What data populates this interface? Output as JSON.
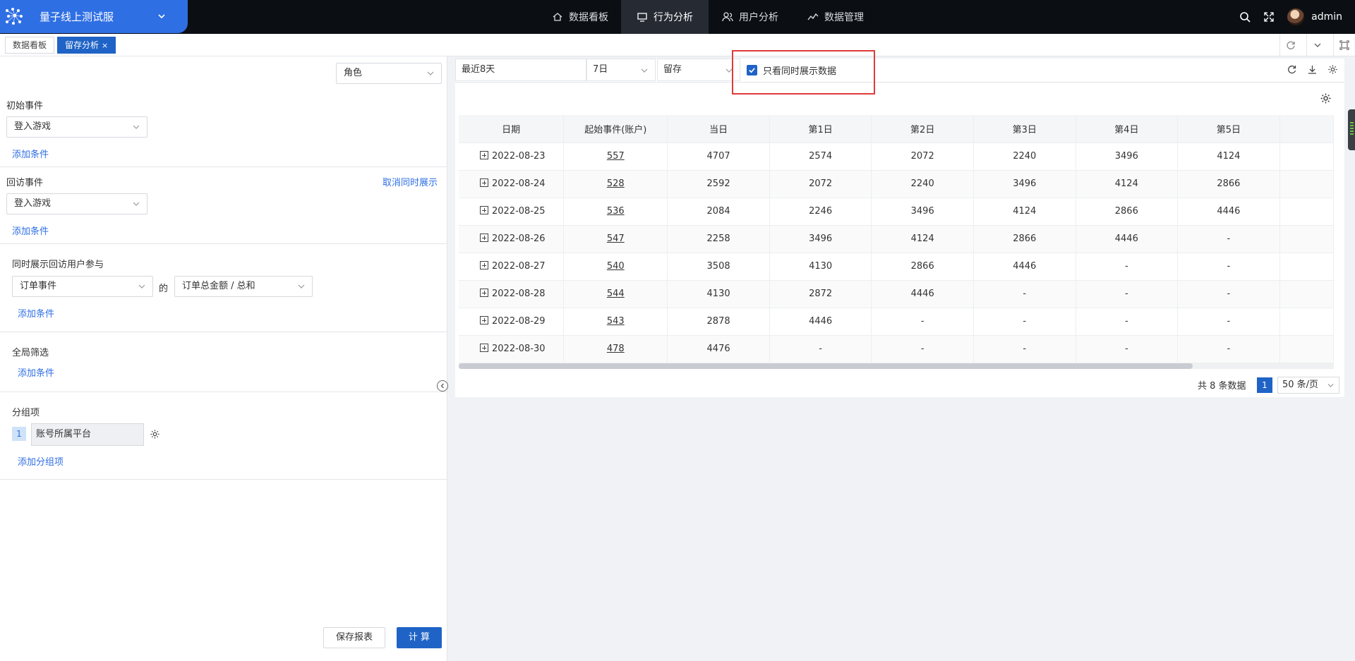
{
  "app": {
    "title": "量子线上测试服",
    "nav": [
      {
        "label": "数据看板",
        "icon": "home-icon"
      },
      {
        "label": "行为分析",
        "icon": "monitor-icon",
        "active": true
      },
      {
        "label": "用户分析",
        "icon": "users-icon"
      },
      {
        "label": "数据管理",
        "icon": "trend-icon"
      }
    ],
    "user": "admin"
  },
  "tabs": [
    {
      "label": "数据看板",
      "active": false
    },
    {
      "label": "留存分析",
      "active": true,
      "close": "×"
    }
  ],
  "left": {
    "role_select": "角色",
    "initial_event_label": "初始事件",
    "initial_event_value": "登入游戏",
    "add_condition": "添加条件",
    "return_event_label": "回访事件",
    "cancel_simultaneous": "取消同时展示",
    "return_event_value": "登入游戏",
    "simultaneous_label": "同时展示回访用户参与",
    "order_event": "订单事件",
    "of": "的",
    "order_metric": "订单总金额 / 总和",
    "global_filter_label": "全局筛选",
    "group_label": "分组项",
    "group_index": "1",
    "group_value": "账号所属平台",
    "add_group": "添加分组项",
    "save_button": "保存报表",
    "compute_button": "计 算"
  },
  "toolbar": {
    "range": "最近8天",
    "period": "7日",
    "metric": "留存",
    "only_simultaneous": "只看同时展示数据"
  },
  "table": {
    "headers": [
      "日期",
      "起始事件(账户)",
      "当日",
      "第1日",
      "第2日",
      "第3日",
      "第4日",
      "第5日"
    ],
    "rows": [
      [
        "2022-08-23",
        "557",
        "4707",
        "2574",
        "2072",
        "2240",
        "3496",
        "4124"
      ],
      [
        "2022-08-24",
        "528",
        "2592",
        "2072",
        "2240",
        "3496",
        "4124",
        "2866"
      ],
      [
        "2022-08-25",
        "536",
        "2084",
        "2246",
        "3496",
        "4124",
        "2866",
        "4446"
      ],
      [
        "2022-08-26",
        "547",
        "2258",
        "3496",
        "4124",
        "2866",
        "4446",
        "-"
      ],
      [
        "2022-08-27",
        "540",
        "3508",
        "4130",
        "2866",
        "4446",
        "-",
        "-"
      ],
      [
        "2022-08-28",
        "544",
        "4130",
        "2872",
        "4446",
        "-",
        "-",
        "-"
      ],
      [
        "2022-08-29",
        "543",
        "2878",
        "4446",
        "-",
        "-",
        "-",
        "-"
      ],
      [
        "2022-08-30",
        "478",
        "4476",
        "-",
        "-",
        "-",
        "-",
        "-"
      ]
    ]
  },
  "pagination": {
    "total": "共 8 条数据",
    "page": "1",
    "page_size": "50 条/页"
  },
  "colors": {
    "brand": "#2f6fe4",
    "primary": "#1f63c6",
    "topbar": "#0b0f14",
    "highlight": "#e03a3a"
  }
}
